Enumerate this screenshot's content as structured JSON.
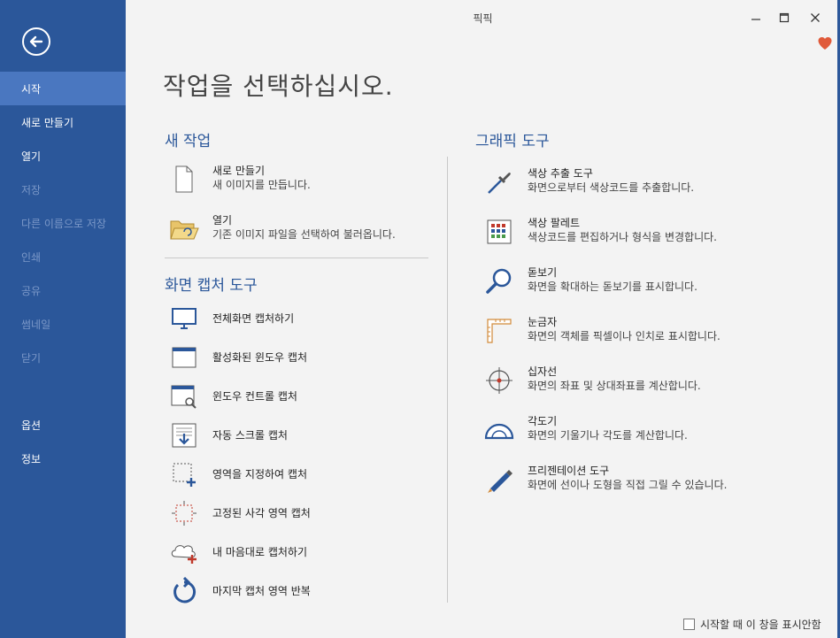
{
  "window": {
    "title": "픽픽"
  },
  "sidebar": {
    "items": [
      {
        "label": "시작"
      },
      {
        "label": "새로 만들기"
      },
      {
        "label": "열기"
      },
      {
        "label": "저장"
      },
      {
        "label": "다른 이름으로 저장"
      },
      {
        "label": "인쇄"
      },
      {
        "label": "공유"
      },
      {
        "label": "썸네일"
      },
      {
        "label": "닫기"
      },
      {
        "label": "옵션"
      },
      {
        "label": "정보"
      }
    ]
  },
  "main": {
    "title": "작업을 선택하십시오.",
    "new_task": {
      "heading": "새 작업",
      "items": [
        {
          "title": "새로 만들기",
          "desc": "새 이미지를 만듭니다."
        },
        {
          "title": "열기",
          "desc": "기존 이미지 파일을 선택하여 불러옵니다."
        }
      ]
    },
    "capture": {
      "heading": "화면 캡처 도구",
      "items": [
        {
          "label": "전체화면 캡처하기"
        },
        {
          "label": "활성화된 윈도우 캡처"
        },
        {
          "label": "윈도우 컨트롤 캡처"
        },
        {
          "label": "자동 스크롤 캡처"
        },
        {
          "label": "영역을 지정하여 캡처"
        },
        {
          "label": "고정된 사각 영역 캡처"
        },
        {
          "label": "내 마음대로 캡처하기"
        },
        {
          "label": "마지막 캡처 영역 반복"
        }
      ]
    },
    "graphic": {
      "heading": "그래픽 도구",
      "items": [
        {
          "title": "색상 추출 도구",
          "desc": "화면으로부터 색상코드를 추출합니다."
        },
        {
          "title": "색상 팔레트",
          "desc": "색상코드를 편집하거나 형식을 변경합니다."
        },
        {
          "title": "돋보기",
          "desc": "화면을 확대하는 돋보기를 표시합니다."
        },
        {
          "title": "눈금자",
          "desc": "화면의 객체를 픽셀이나 인치로 표시합니다."
        },
        {
          "title": "십자선",
          "desc": "화면의 좌표 및 상대좌표를 계산합니다."
        },
        {
          "title": "각도기",
          "desc": "화면의 기울기나 각도를 계산합니다."
        },
        {
          "title": "프리젠테이션 도구",
          "desc": "화면에 선이나 도형을 직접 그릴 수 있습니다."
        }
      ]
    }
  },
  "footer": {
    "checkbox_label": "시작할 때 이 창을 표시안함",
    "checked": false
  },
  "colors": {
    "sidebar": "#2b579a",
    "active": "#4a77c0",
    "accent": "#2b579a",
    "heart": "#e05a3a"
  }
}
